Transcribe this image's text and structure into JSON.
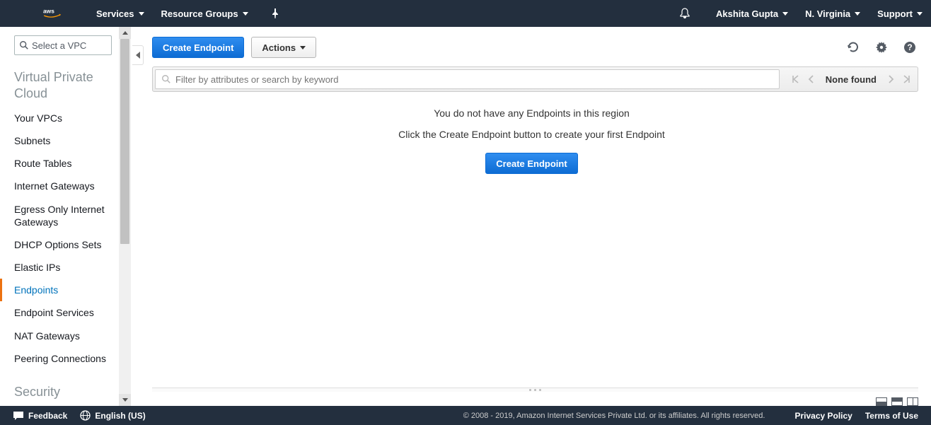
{
  "topnav": {
    "services": "Services",
    "resource_groups": "Resource Groups",
    "user": "Akshita Gupta",
    "region": "N. Virginia",
    "support": "Support"
  },
  "sidebar": {
    "vpc_selector_placeholder": "Select a VPC",
    "heading": "Virtual Private Cloud",
    "heading2": "Security",
    "items": [
      {
        "label": "Your VPCs"
      },
      {
        "label": "Subnets"
      },
      {
        "label": "Route Tables"
      },
      {
        "label": "Internet Gateways"
      },
      {
        "label": "Egress Only Internet Gateways"
      },
      {
        "label": "DHCP Options Sets"
      },
      {
        "label": "Elastic IPs"
      },
      {
        "label": "Endpoints"
      },
      {
        "label": "Endpoint Services"
      },
      {
        "label": "NAT Gateways"
      },
      {
        "label": "Peering Connections"
      }
    ]
  },
  "toolbar": {
    "create_label": "Create Endpoint",
    "actions_label": "Actions"
  },
  "filter": {
    "placeholder": "Filter by attributes or search by keyword",
    "pager_label": "None found"
  },
  "empty": {
    "line1": "You do not have any Endpoints in this region",
    "line2": "Click the Create Endpoint button to create your first Endpoint",
    "button": "Create Endpoint"
  },
  "footer": {
    "feedback": "Feedback",
    "language": "English (US)",
    "copyright": "© 2008 - 2019, Amazon Internet Services Private Ltd. or its affiliates. All rights reserved.",
    "privacy": "Privacy Policy",
    "terms": "Terms of Use"
  }
}
